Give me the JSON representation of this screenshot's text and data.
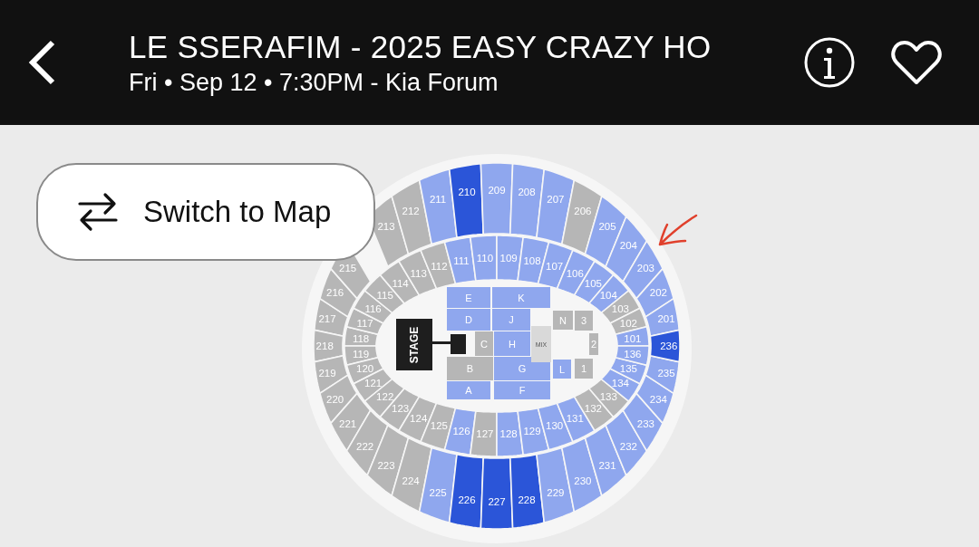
{
  "header": {
    "title": "LE SSERAFIM - 2025 EASY CRAZY HO",
    "subtitle": "Fri • Sep 12 • 7:30PM - Kia Forum"
  },
  "switch_button": {
    "label": "Switch to Map"
  },
  "upper_top_sections": [
    {
      "label": "217",
      "sold": true,
      "highlighted": false
    },
    {
      "label": "216",
      "sold": true,
      "highlighted": false
    },
    {
      "label": "215",
      "sold": true,
      "highlighted": false
    },
    {
      "label": "213",
      "sold": true,
      "highlighted": false
    },
    {
      "label": "212",
      "sold": true,
      "highlighted": false
    },
    {
      "label": "211",
      "sold": false,
      "highlighted": false
    },
    {
      "label": "210",
      "sold": false,
      "highlighted": true
    },
    {
      "label": "209",
      "sold": false,
      "highlighted": false
    },
    {
      "label": "208",
      "sold": false,
      "highlighted": false
    },
    {
      "label": "207",
      "sold": false,
      "highlighted": false
    },
    {
      "label": "206",
      "sold": true,
      "highlighted": false
    },
    {
      "label": "205",
      "sold": false,
      "highlighted": false
    },
    {
      "label": "204",
      "sold": false,
      "highlighted": false
    },
    {
      "label": "203",
      "sold": false,
      "highlighted": false
    },
    {
      "label": "202",
      "sold": false,
      "highlighted": false
    },
    {
      "label": "201",
      "sold": false,
      "highlighted": false
    }
  ],
  "upper_bottom_sections": [
    {
      "label": "218",
      "sold": true,
      "highlighted": false
    },
    {
      "label": "219",
      "sold": true,
      "highlighted": false
    },
    {
      "label": "220",
      "sold": true,
      "highlighted": false
    },
    {
      "label": "221",
      "sold": true,
      "highlighted": false
    },
    {
      "label": "222",
      "sold": true,
      "highlighted": false
    },
    {
      "label": "223",
      "sold": true,
      "highlighted": false
    },
    {
      "label": "224",
      "sold": true,
      "highlighted": false
    },
    {
      "label": "225",
      "sold": false,
      "highlighted": false
    },
    {
      "label": "226",
      "sold": false,
      "highlighted": true
    },
    {
      "label": "227",
      "sold": false,
      "highlighted": true
    },
    {
      "label": "228",
      "sold": false,
      "highlighted": true
    },
    {
      "label": "229",
      "sold": false,
      "highlighted": false
    },
    {
      "label": "230",
      "sold": false,
      "highlighted": false
    },
    {
      "label": "231",
      "sold": false,
      "highlighted": false
    },
    {
      "label": "232",
      "sold": false,
      "highlighted": false
    },
    {
      "label": "233",
      "sold": false,
      "highlighted": false
    },
    {
      "label": "234",
      "sold": false,
      "highlighted": false
    },
    {
      "label": "235",
      "sold": false,
      "highlighted": false
    },
    {
      "label": "236",
      "sold": false,
      "highlighted": true
    }
  ],
  "lower_top_sections": [
    {
      "label": "118",
      "sold": true
    },
    {
      "label": "117",
      "sold": true
    },
    {
      "label": "116",
      "sold": true
    },
    {
      "label": "115",
      "sold": true
    },
    {
      "label": "114",
      "sold": true
    },
    {
      "label": "113",
      "sold": true
    },
    {
      "label": "112",
      "sold": true
    },
    {
      "label": "111",
      "sold": false
    },
    {
      "label": "110",
      "sold": false
    },
    {
      "label": "109",
      "sold": false
    },
    {
      "label": "108",
      "sold": false
    },
    {
      "label": "107",
      "sold": false
    },
    {
      "label": "106",
      "sold": false
    },
    {
      "label": "105",
      "sold": false
    },
    {
      "label": "104",
      "sold": false
    },
    {
      "label": "103",
      "sold": true
    },
    {
      "label": "102",
      "sold": true
    },
    {
      "label": "101",
      "sold": false
    }
  ],
  "lower_bottom_sections": [
    {
      "label": "119",
      "sold": true
    },
    {
      "label": "120",
      "sold": true
    },
    {
      "label": "121",
      "sold": true
    },
    {
      "label": "122",
      "sold": true
    },
    {
      "label": "123",
      "sold": true
    },
    {
      "label": "124",
      "sold": true
    },
    {
      "label": "125",
      "sold": true
    },
    {
      "label": "126",
      "sold": false
    },
    {
      "label": "127",
      "sold": true
    },
    {
      "label": "128",
      "sold": false
    },
    {
      "label": "129",
      "sold": false
    },
    {
      "label": "130",
      "sold": false
    },
    {
      "label": "131",
      "sold": false
    },
    {
      "label": "132",
      "sold": true
    },
    {
      "label": "133",
      "sold": true
    },
    {
      "label": "134",
      "sold": false
    },
    {
      "label": "135",
      "sold": false
    },
    {
      "label": "136",
      "sold": false
    }
  ],
  "floor_sections": [
    {
      "label": "E",
      "sold": false
    },
    {
      "label": "K",
      "sold": false
    },
    {
      "label": "D",
      "sold": false
    },
    {
      "label": "J",
      "sold": false
    },
    {
      "label": "C",
      "sold": true
    },
    {
      "label": "H",
      "sold": false
    },
    {
      "label": "B",
      "sold": true
    },
    {
      "label": "G",
      "sold": false
    },
    {
      "label": "A",
      "sold": false
    },
    {
      "label": "F",
      "sold": false
    },
    {
      "label": "N",
      "sold": true
    },
    {
      "label": "3",
      "sold": true
    },
    {
      "label": "2",
      "sold": true
    },
    {
      "label": "L",
      "sold": false
    },
    {
      "label": "1",
      "sold": true
    }
  ],
  "mix": {
    "label": "MIX"
  },
  "stage": {
    "label": "STAGE"
  }
}
